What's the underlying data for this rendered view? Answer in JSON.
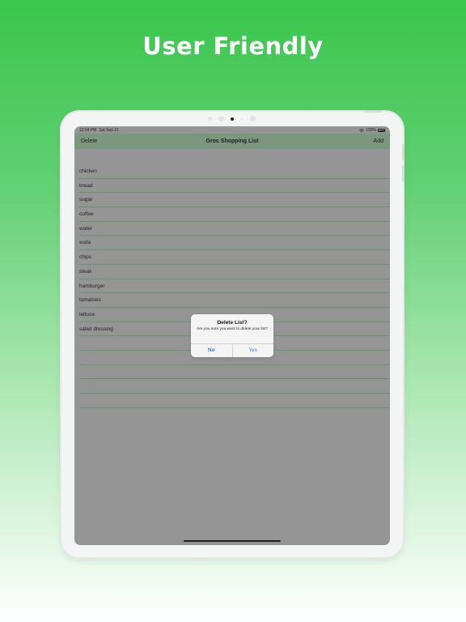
{
  "headline": "User Friendly",
  "status_bar": {
    "time": "12:04 PM",
    "date": "Sat Sep 21",
    "battery": "100%",
    "battery_level": 1.0
  },
  "nav": {
    "left_label": "Delete",
    "title": "Groc Shopping List",
    "right_label": "Add"
  },
  "list_items": [
    "chicken",
    "bread",
    "sugar",
    "coffee",
    "water",
    "soda",
    "chips",
    "steak",
    "hamburger",
    "tomatoes",
    "lettuce",
    "salad dressing",
    "",
    "",
    "",
    "",
    ""
  ],
  "alert": {
    "title": "Delete List?",
    "message": "Are you sure you want to delete your list?",
    "no_label": "No",
    "yes_label": "Yes"
  },
  "colors": {
    "background_top": "#3ac64c",
    "navbar": "#7b977e",
    "screen": "#959595",
    "alert_button": "#2f7ee0"
  }
}
